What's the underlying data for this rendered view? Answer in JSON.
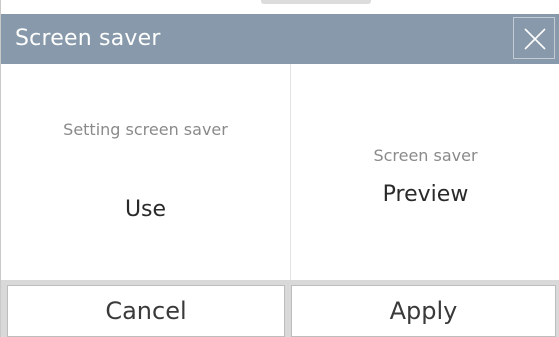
{
  "dialog": {
    "title": "Screen saver",
    "close_icon": "close-icon"
  },
  "setting_panel": {
    "caption": "Setting screen saver",
    "value": "Use"
  },
  "preview_panel": {
    "caption": "Screen saver",
    "value": "Preview"
  },
  "buttons": {
    "cancel_label": "Cancel",
    "apply_label": "Apply"
  },
  "colors": {
    "titlebar": "#8799aa",
    "title_text": "#ffffff",
    "caption_text": "#8a8a8a",
    "value_text": "#2a2a2a"
  }
}
